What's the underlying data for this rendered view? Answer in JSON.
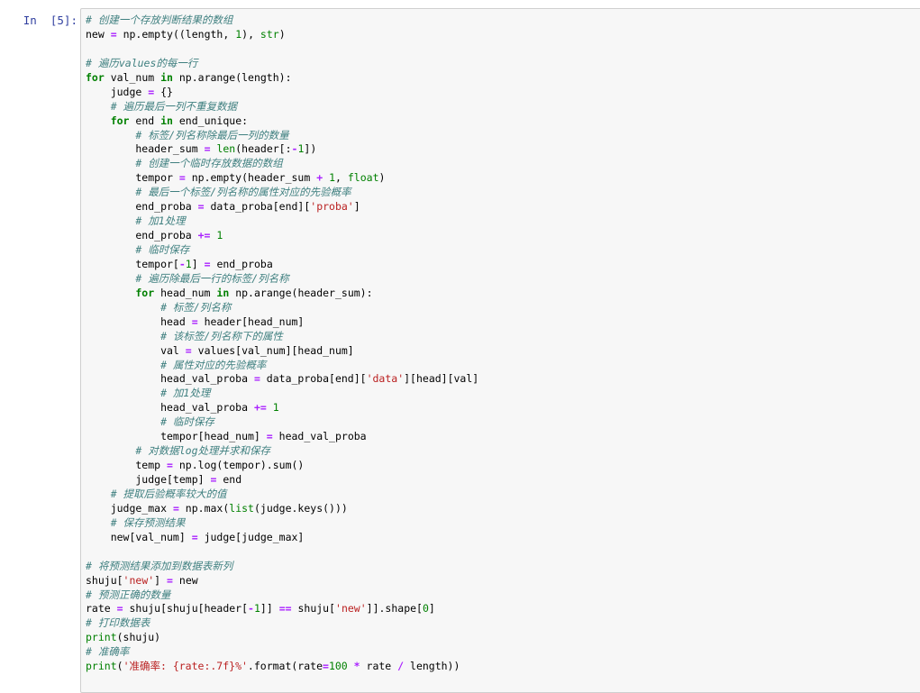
{
  "cell": {
    "prompt": "In  [5]:"
  },
  "colors": {
    "keyword": "#008000",
    "comment": "#408080",
    "operator": "#aa22ff",
    "number": "#008000",
    "string": "#ba2121",
    "prompt": "#303f9f",
    "cell_background": "#f7f7f7",
    "cell_border": "#cfcfcf"
  },
  "code_lines": [
    [
      {
        "t": "comment",
        "v": "# 创建一个存放判断结果的数组"
      }
    ],
    [
      {
        "t": "name",
        "v": "new "
      },
      {
        "t": "op",
        "v": "="
      },
      {
        "t": "name",
        "v": " np.empty((length, "
      },
      {
        "t": "num",
        "v": "1"
      },
      {
        "t": "name",
        "v": "), "
      },
      {
        "t": "builtin",
        "v": "str"
      },
      {
        "t": "name",
        "v": ")"
      }
    ],
    [],
    [
      {
        "t": "comment",
        "v": "# 遍历values的每一行"
      }
    ],
    [
      {
        "t": "kw",
        "v": "for"
      },
      {
        "t": "name",
        "v": " val_num "
      },
      {
        "t": "kw",
        "v": "in"
      },
      {
        "t": "name",
        "v": " np.arange(length):"
      }
    ],
    [
      {
        "t": "name",
        "v": "    judge "
      },
      {
        "t": "op",
        "v": "="
      },
      {
        "t": "name",
        "v": " {}"
      }
    ],
    [
      {
        "t": "comment",
        "v": "    # 遍历最后一列不重复数据"
      }
    ],
    [
      {
        "t": "kw",
        "v": "    for"
      },
      {
        "t": "name",
        "v": " end "
      },
      {
        "t": "kw",
        "v": "in"
      },
      {
        "t": "name",
        "v": " end_unique:"
      }
    ],
    [
      {
        "t": "comment",
        "v": "        # 标签/列名称除最后一列的数量"
      }
    ],
    [
      {
        "t": "name",
        "v": "        header_sum "
      },
      {
        "t": "op",
        "v": "="
      },
      {
        "t": "name",
        "v": " "
      },
      {
        "t": "builtin",
        "v": "len"
      },
      {
        "t": "name",
        "v": "(header[:"
      },
      {
        "t": "op",
        "v": "-"
      },
      {
        "t": "num",
        "v": "1"
      },
      {
        "t": "name",
        "v": "])"
      }
    ],
    [
      {
        "t": "comment",
        "v": "        # 创建一个临时存放数据的数组"
      }
    ],
    [
      {
        "t": "name",
        "v": "        tempor "
      },
      {
        "t": "op",
        "v": "="
      },
      {
        "t": "name",
        "v": " np.empty(header_sum "
      },
      {
        "t": "op",
        "v": "+"
      },
      {
        "t": "name",
        "v": " "
      },
      {
        "t": "num",
        "v": "1"
      },
      {
        "t": "name",
        "v": ", "
      },
      {
        "t": "builtin",
        "v": "float"
      },
      {
        "t": "name",
        "v": ")"
      }
    ],
    [
      {
        "t": "comment",
        "v": "        # 最后一个标签/列名称的属性对应的先验概率"
      }
    ],
    [
      {
        "t": "name",
        "v": "        end_proba "
      },
      {
        "t": "op",
        "v": "="
      },
      {
        "t": "name",
        "v": " data_proba[end]["
      },
      {
        "t": "str",
        "v": "'proba'"
      },
      {
        "t": "name",
        "v": "]"
      }
    ],
    [
      {
        "t": "comment",
        "v": "        # 加1处理"
      }
    ],
    [
      {
        "t": "name",
        "v": "        end_proba "
      },
      {
        "t": "op",
        "v": "+="
      },
      {
        "t": "name",
        "v": " "
      },
      {
        "t": "num",
        "v": "1"
      }
    ],
    [
      {
        "t": "comment",
        "v": "        # 临时保存"
      }
    ],
    [
      {
        "t": "name",
        "v": "        tempor["
      },
      {
        "t": "op",
        "v": "-"
      },
      {
        "t": "num",
        "v": "1"
      },
      {
        "t": "name",
        "v": "] "
      },
      {
        "t": "op",
        "v": "="
      },
      {
        "t": "name",
        "v": " end_proba"
      }
    ],
    [
      {
        "t": "comment",
        "v": "        # 遍历除最后一行的标签/列名称"
      }
    ],
    [
      {
        "t": "kw",
        "v": "        for"
      },
      {
        "t": "name",
        "v": " head_num "
      },
      {
        "t": "kw",
        "v": "in"
      },
      {
        "t": "name",
        "v": " np.arange(header_sum):"
      }
    ],
    [
      {
        "t": "comment",
        "v": "            # 标签/列名称"
      }
    ],
    [
      {
        "t": "name",
        "v": "            head "
      },
      {
        "t": "op",
        "v": "="
      },
      {
        "t": "name",
        "v": " header[head_num]"
      }
    ],
    [
      {
        "t": "comment",
        "v": "            # 该标签/列名称下的属性"
      }
    ],
    [
      {
        "t": "name",
        "v": "            val "
      },
      {
        "t": "op",
        "v": "="
      },
      {
        "t": "name",
        "v": " values[val_num][head_num]"
      }
    ],
    [
      {
        "t": "comment",
        "v": "            # 属性对应的先验概率"
      }
    ],
    [
      {
        "t": "name",
        "v": "            head_val_proba "
      },
      {
        "t": "op",
        "v": "="
      },
      {
        "t": "name",
        "v": " data_proba[end]["
      },
      {
        "t": "str",
        "v": "'data'"
      },
      {
        "t": "name",
        "v": "][head][val]"
      }
    ],
    [
      {
        "t": "comment",
        "v": "            # 加1处理"
      }
    ],
    [
      {
        "t": "name",
        "v": "            head_val_proba "
      },
      {
        "t": "op",
        "v": "+="
      },
      {
        "t": "name",
        "v": " "
      },
      {
        "t": "num",
        "v": "1"
      }
    ],
    [
      {
        "t": "comment",
        "v": "            # 临时保存"
      }
    ],
    [
      {
        "t": "name",
        "v": "            tempor[head_num] "
      },
      {
        "t": "op",
        "v": "="
      },
      {
        "t": "name",
        "v": " head_val_proba"
      }
    ],
    [
      {
        "t": "comment",
        "v": "        # 对数据log处理并求和保存"
      }
    ],
    [
      {
        "t": "name",
        "v": "        temp "
      },
      {
        "t": "op",
        "v": "="
      },
      {
        "t": "name",
        "v": " np.log(tempor).sum()"
      }
    ],
    [
      {
        "t": "name",
        "v": "        judge[temp] "
      },
      {
        "t": "op",
        "v": "="
      },
      {
        "t": "name",
        "v": " end"
      }
    ],
    [
      {
        "t": "comment",
        "v": "    # 提取后验概率较大的值"
      }
    ],
    [
      {
        "t": "name",
        "v": "    judge_max "
      },
      {
        "t": "op",
        "v": "="
      },
      {
        "t": "name",
        "v": " np.max("
      },
      {
        "t": "builtin",
        "v": "list"
      },
      {
        "t": "name",
        "v": "(judge.keys()))"
      }
    ],
    [
      {
        "t": "comment",
        "v": "    # 保存预测结果"
      }
    ],
    [
      {
        "t": "name",
        "v": "    new[val_num] "
      },
      {
        "t": "op",
        "v": "="
      },
      {
        "t": "name",
        "v": " judge[judge_max]"
      }
    ],
    [],
    [
      {
        "t": "comment",
        "v": "# 将预测结果添加到数据表新列"
      }
    ],
    [
      {
        "t": "name",
        "v": "shuju["
      },
      {
        "t": "str",
        "v": "'new'"
      },
      {
        "t": "name",
        "v": "] "
      },
      {
        "t": "op",
        "v": "="
      },
      {
        "t": "name",
        "v": " new"
      }
    ],
    [
      {
        "t": "comment",
        "v": "# 预测正确的数量"
      }
    ],
    [
      {
        "t": "name",
        "v": "rate "
      },
      {
        "t": "op",
        "v": "="
      },
      {
        "t": "name",
        "v": " shuju[shuju[header["
      },
      {
        "t": "op",
        "v": "-"
      },
      {
        "t": "num",
        "v": "1"
      },
      {
        "t": "name",
        "v": "]] "
      },
      {
        "t": "op",
        "v": "=="
      },
      {
        "t": "name",
        "v": " shuju["
      },
      {
        "t": "str",
        "v": "'new'"
      },
      {
        "t": "name",
        "v": "]].shape["
      },
      {
        "t": "num",
        "v": "0"
      },
      {
        "t": "name",
        "v": "]"
      }
    ],
    [
      {
        "t": "comment",
        "v": "# 打印数据表"
      }
    ],
    [
      {
        "t": "builtin",
        "v": "print"
      },
      {
        "t": "name",
        "v": "(shuju)"
      }
    ],
    [
      {
        "t": "comment",
        "v": "# 准确率"
      }
    ],
    [
      {
        "t": "builtin",
        "v": "print"
      },
      {
        "t": "name",
        "v": "("
      },
      {
        "t": "str",
        "v": "'准确率: {rate:.7f}%'"
      },
      {
        "t": "name",
        "v": ".format(rate"
      },
      {
        "t": "op",
        "v": "="
      },
      {
        "t": "num",
        "v": "100"
      },
      {
        "t": "name",
        "v": " "
      },
      {
        "t": "op",
        "v": "*"
      },
      {
        "t": "name",
        "v": " rate "
      },
      {
        "t": "op",
        "v": "/"
      },
      {
        "t": "name",
        "v": " length))"
      }
    ]
  ]
}
